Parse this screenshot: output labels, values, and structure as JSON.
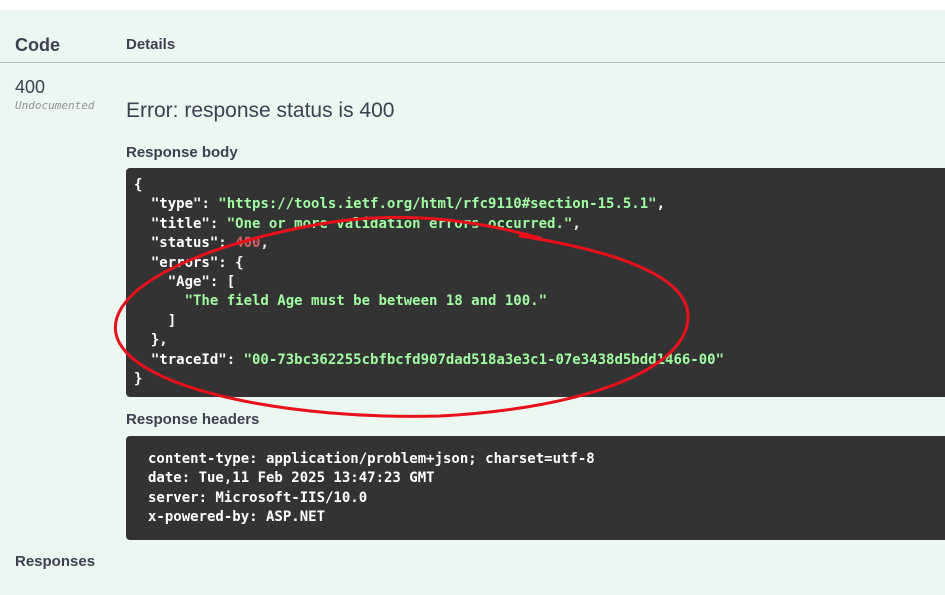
{
  "table": {
    "code_header": "Code",
    "details_header": "Details"
  },
  "response": {
    "code": "400",
    "documentation_status": "Undocumented",
    "error_title": "Error: response status is 400",
    "body_label": "Response body",
    "body": {
      "open": "{",
      "type_key": "\"type\"",
      "type_value": "\"https://tools.ietf.org/html/rfc9110#section-15.5.1\"",
      "title_key": "\"title\"",
      "title_value": "\"One or more validation errors occurred.\"",
      "status_key": "\"status\"",
      "status_value": "400",
      "errors_key": "\"errors\"",
      "errors_open": ": {",
      "age_key": "\"Age\"",
      "age_open": ": [",
      "age_message": "\"The field Age must be between 18 and 100.\"",
      "age_close": "]",
      "errors_close": "},",
      "traceid_key": "\"traceId\"",
      "traceid_value": "\"00-73bc362255cbfbcfd907dad518a3e3c1-07e3438d5bdd1466-00\"",
      "close": "}"
    },
    "headers_label": "Response headers",
    "headers": [
      "content-type: application/problem+json; charset=utf-8",
      "date: Tue,11 Feb 2025 13:47:23 GMT",
      "server: Microsoft-IIS/10.0",
      "x-powered-by: ASP.NET"
    ]
  },
  "footer": {
    "responses_label": "Responses"
  },
  "colors": {
    "panel_background": "#ebf8f2",
    "code_background": "#333333",
    "string_color": "#a2fca2",
    "number_color": "#d36363",
    "annotation_color": "#e8101a"
  }
}
